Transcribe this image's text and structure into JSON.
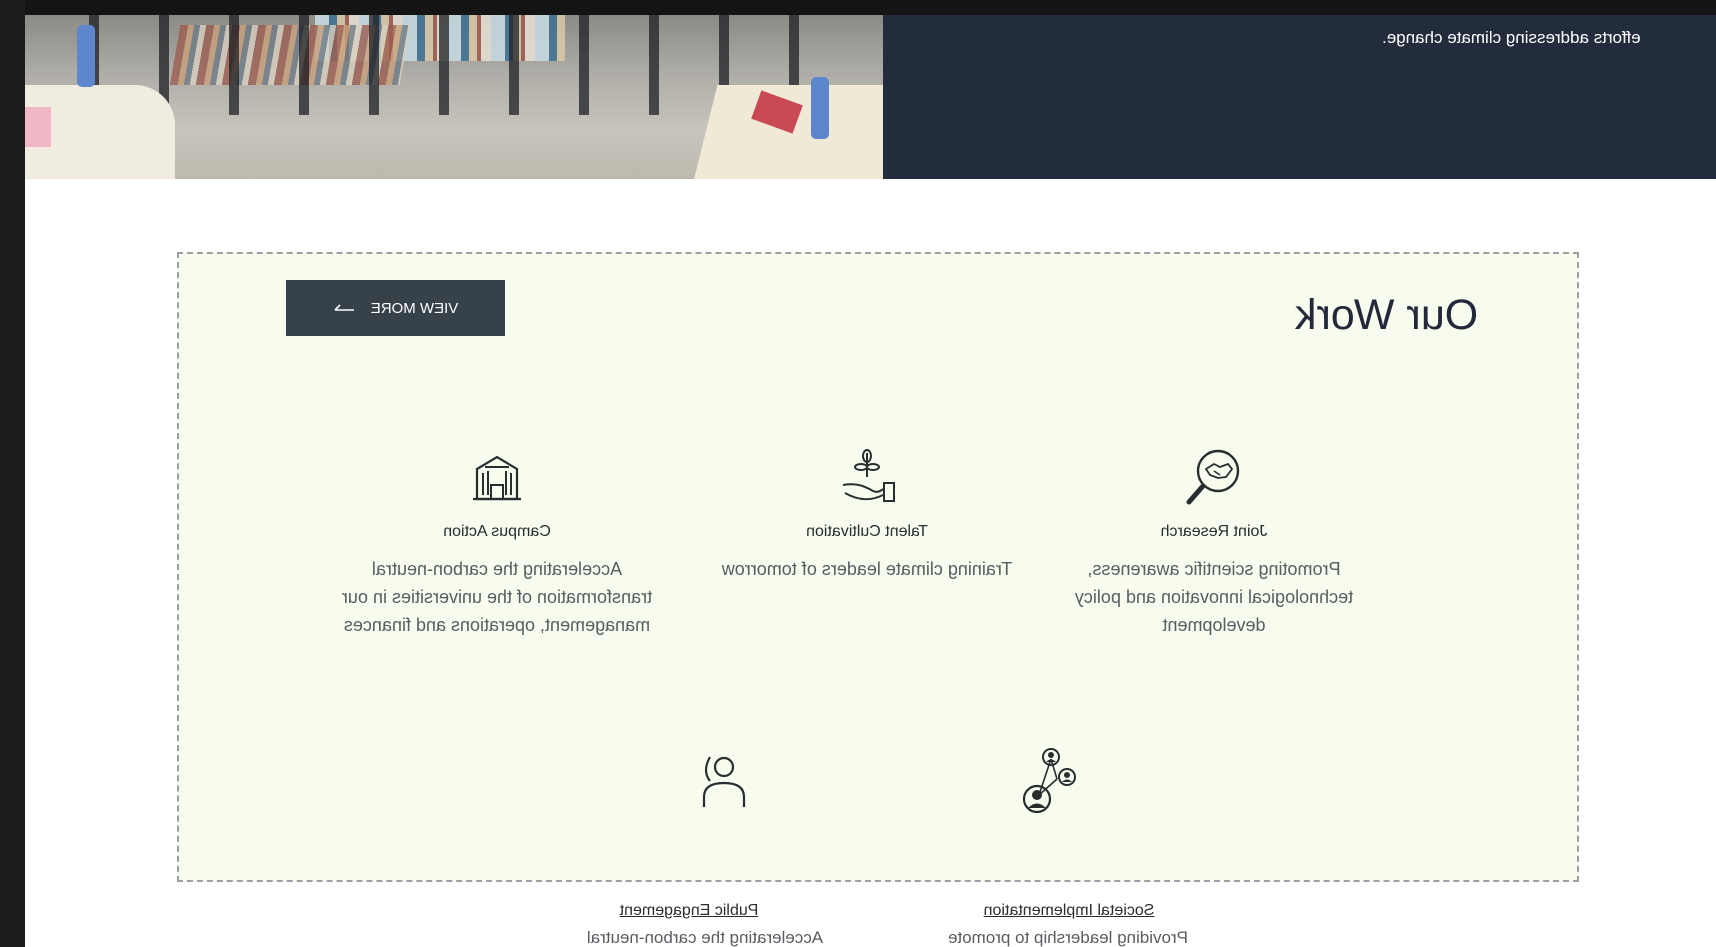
{
  "hero": {
    "text": "efforts addressing climate change."
  },
  "our_work": {
    "title": "Our Work",
    "view_more_label": "VIEW MORE",
    "items": [
      {
        "title": "Joint Research",
        "description": "Promoting scientific awareness, technological innovation and policy development",
        "icon": "handshake-magnifier-icon"
      },
      {
        "title": "Talent Cultivation",
        "description": "Training climate leaders of tomorrow",
        "icon": "hand-sprout-icon"
      },
      {
        "title": "Campus Action",
        "description": "Accelerating the carbon-neutral transformation of the universities in our management, operations and finances",
        "icon": "building-icon"
      },
      {
        "title": "Societal Implementation",
        "description": "Providing leadership to promote",
        "icon": "network-people-icon"
      },
      {
        "title": "Public Engagement",
        "description": "Accelerating the carbon-neutral",
        "icon": "person-icon"
      }
    ]
  }
}
